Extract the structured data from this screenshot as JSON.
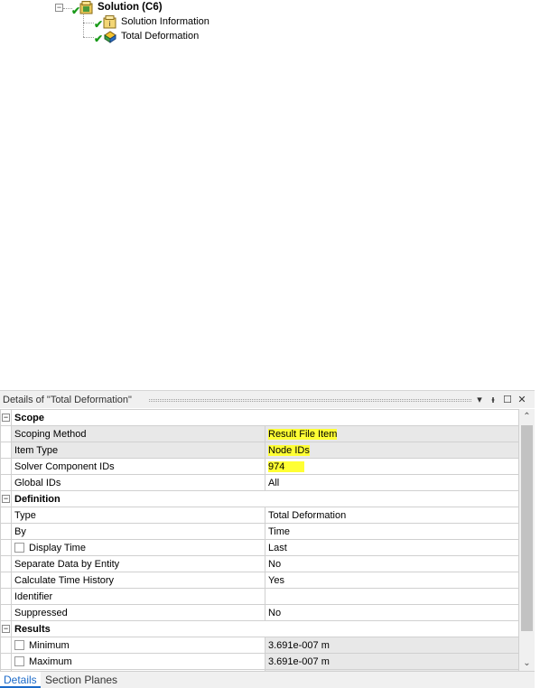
{
  "tree": {
    "solution_label": "Solution (C6)",
    "solution_info_label": "Solution Information",
    "total_deformation_label": "Total Deformation"
  },
  "details": {
    "title": "Details of \"Total Deformation\"",
    "toolbar": {
      "dropdown_icon": "▾",
      "pin_icon": "🖈",
      "maximize_icon": "☐",
      "close_icon": "✕"
    },
    "sections": {
      "scope": "Scope",
      "definition": "Definition",
      "results": "Results"
    },
    "rows": {
      "scoping_method": {
        "label": "Scoping Method",
        "value": "Result File Item"
      },
      "item_type": {
        "label": "Item Type",
        "value": "Node IDs"
      },
      "solver_component_ids": {
        "label": "Solver Component IDs",
        "value": "974"
      },
      "global_ids": {
        "label": "Global IDs",
        "value": "All"
      },
      "type": {
        "label": "Type",
        "value": "Total Deformation"
      },
      "by": {
        "label": "By",
        "value": "Time"
      },
      "display_time": {
        "label": "Display Time",
        "value": "Last"
      },
      "separate_data": {
        "label": "Separate Data by Entity",
        "value": "No"
      },
      "calc_time_history": {
        "label": "Calculate Time History",
        "value": "Yes"
      },
      "identifier": {
        "label": "Identifier",
        "value": ""
      },
      "suppressed": {
        "label": "Suppressed",
        "value": "No"
      },
      "minimum": {
        "label": "Minimum",
        "value": "3.691e-007 m"
      },
      "maximum": {
        "label": "Maximum",
        "value": "3.691e-007 m"
      }
    }
  },
  "tabs": {
    "details": "Details",
    "section_planes": "Section Planes"
  },
  "colors": {
    "highlight": "#ffff33",
    "check_green": "#1a9a1a",
    "active_tab": "#1b6ac9"
  }
}
